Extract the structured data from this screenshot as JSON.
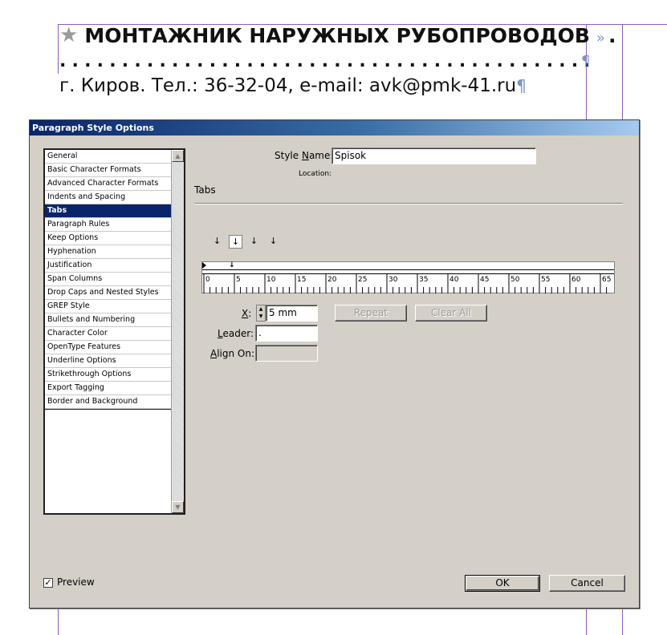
{
  "document": {
    "heading": "МОНТАЖНИК НАРУЖНЫХ РУБОПРОВОДОВ",
    "heading_trail": ".",
    "leader_dots": "...........................................................",
    "contact_line": "г. Киров. Тел.: 36-32-04, e-mail: avk@pmk-41.ru",
    "pilcrow": "¶"
  },
  "dialog": {
    "title": "Paragraph Style Options",
    "categories": [
      "General",
      "Basic Character Formats",
      "Advanced Character Formats",
      "Indents and Spacing",
      "Tabs",
      "Paragraph Rules",
      "Keep Options",
      "Hyphenation",
      "Justification",
      "Span Columns",
      "Drop Caps and Nested Styles",
      "GREP Style",
      "Bullets and Numbering",
      "Character Color",
      "OpenType Features",
      "Underline Options",
      "Strikethrough Options",
      "Export Tagging",
      "Border and Background"
    ],
    "selected_category": "Tabs",
    "style_name_label_pre": "Style ",
    "style_name_label_accel": "N",
    "style_name_label_post": "ame:",
    "style_name_value": "Spisok",
    "location_label": "Location:",
    "section_title": "Tabs",
    "ruler_ticks": [
      "0",
      "5",
      "10",
      "15",
      "20",
      "25",
      "30",
      "35",
      "40",
      "45",
      "50",
      "55",
      "60",
      "65"
    ],
    "x_label_accel": "X",
    "x_label_post": ":",
    "x_value": "5 mm",
    "leader_label_accel": "L",
    "leader_label_post": "eader:",
    "leader_value": ".",
    "align_on_label_accel": "A",
    "align_on_label_post": "lign On:",
    "align_on_value": "",
    "repeat_button": "Repeat",
    "clear_all_button": "Clear All",
    "preview_label": "Preview",
    "preview_checked": true,
    "ok_button": "OK",
    "cancel_button": "Cancel"
  }
}
